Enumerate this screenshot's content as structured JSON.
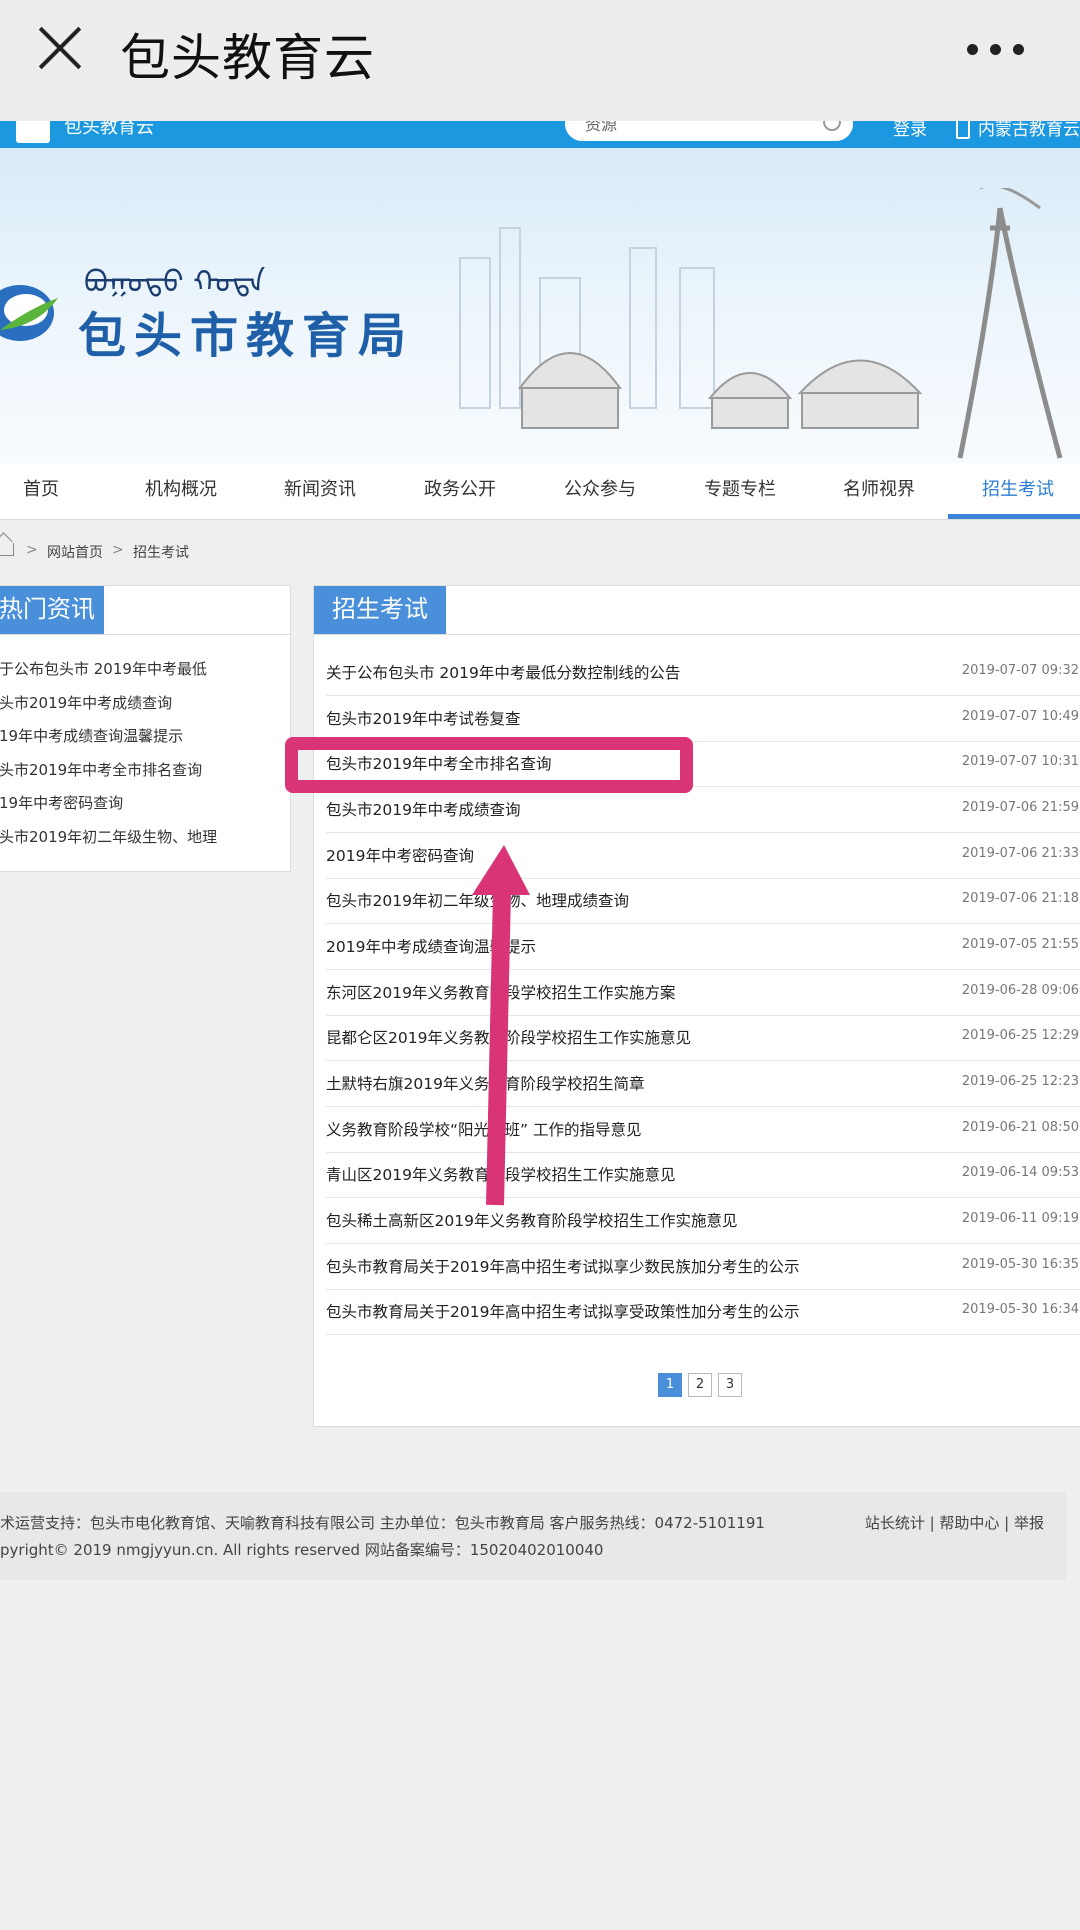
{
  "wechat": {
    "title": "包头教育云",
    "close_icon": "close-icon",
    "more_icon": "more-icon"
  },
  "sitebar": {
    "logo_text": "包头教育云",
    "search_text": "资源",
    "login": "登录",
    "region": "内蒙古教育云"
  },
  "banner": {
    "bureau_name": "包头市教育局",
    "mongolian": "ᠪᠣᠭᠣᠲᠣ ᠬᠣᠲᠠ"
  },
  "nav": {
    "items": [
      "首页",
      "机构概况",
      "新闻资讯",
      "政务公开",
      "公众参与",
      "专题专栏",
      "名师视界",
      "招生考试"
    ],
    "active": "招生考试"
  },
  "breadcrumb": {
    "home": "网站首页",
    "current": "招生考试",
    "separator": ">"
  },
  "hot": {
    "title": "热门资讯",
    "items": [
      "于公布包头市 2019年中考最低",
      "头市2019年中考成绩查询",
      "19年中考成绩查询温馨提示",
      "头市2019年中考全市排名查询",
      "19年中考密码查询",
      "头市2019年初二年级生物、地理"
    ]
  },
  "main": {
    "title": "招生考试",
    "rows": [
      {
        "title": "关于公布包头市 2019年中考最低分数控制线的公告",
        "date": "2019-07-07 09:32"
      },
      {
        "title": "包头市2019年中考试卷复查",
        "date": "2019-07-07 10:49"
      },
      {
        "title": "包头市2019年中考全市排名查询",
        "date": "2019-07-07 10:31"
      },
      {
        "title": "包头市2019年中考成绩查询",
        "date": "2019-07-06 21:59"
      },
      {
        "title": "2019年中考密码查询",
        "date": "2019-07-06 21:33"
      },
      {
        "title": "包头市2019年初二年级生物、地理成绩查询",
        "date": "2019-07-06 21:18"
      },
      {
        "title": "2019年中考成绩查询温馨提示",
        "date": "2019-07-05 21:55"
      },
      {
        "title": "东河区2019年义务教育阶段学校招生工作实施方案",
        "date": "2019-06-28 09:06"
      },
      {
        "title": "昆都仑区2019年义务教育阶段学校招生工作实施意见",
        "date": "2019-06-25 12:29"
      },
      {
        "title": "土默特右旗2019年义务教育阶段学校招生简章",
        "date": "2019-06-25 12:23"
      },
      {
        "title": "义务教育阶段学校“阳光分班” 工作的指导意见",
        "date": "2019-06-21 08:50"
      },
      {
        "title": "青山区2019年义务教育阶段学校招生工作实施意见",
        "date": "2019-06-14 09:53"
      },
      {
        "title": "包头稀土高新区2019年义务教育阶段学校招生工作实施意见",
        "date": "2019-06-11 09:19"
      },
      {
        "title": "包头市教育局关于2019年高中招生考试拟享少数民族加分考生的公示",
        "date": "2019-05-30 16:35"
      },
      {
        "title": "包头市教育局关于2019年高中招生考试拟享受政策性加分考生的公示",
        "date": "2019-05-30 16:34"
      }
    ]
  },
  "pager": {
    "pages": [
      "1",
      "2",
      "3"
    ],
    "current": "1"
  },
  "footer": {
    "line1": "术运营支持：包头市电化教育馆、天喻教育科技有限公司  主办单位：包头市教育局  客户服务热线：0472-5101191",
    "line2": "pyright© 2019 nmgjyyun.cn. All rights reserved 网站备案编号：15020402010040",
    "links": "站长统计  |   帮助中心   | 举报"
  },
  "colors": {
    "accent": "#4a8fd9",
    "highlight": "#d93576",
    "sitebar": "#1c98e0"
  }
}
